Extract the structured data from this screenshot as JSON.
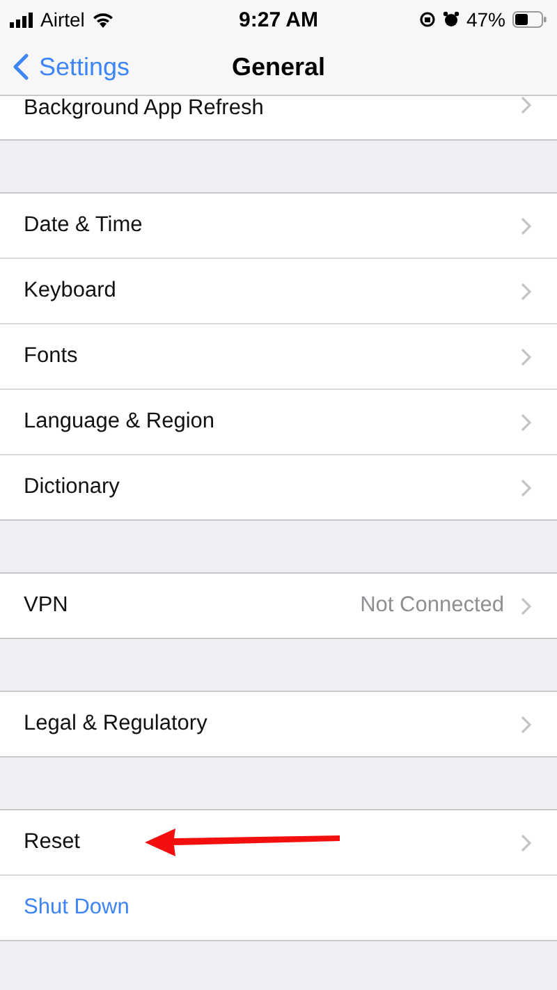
{
  "status_bar": {
    "carrier": "Airtel",
    "time": "9:27 AM",
    "battery": "47%"
  },
  "nav_bar": {
    "back": "Settings",
    "title": "General"
  },
  "groups": [
    {
      "partial": true,
      "rows": [
        {
          "kind": "nav",
          "label": "Background App Refresh"
        }
      ]
    },
    {
      "partial": false,
      "rows": [
        {
          "kind": "nav",
          "label": "Date & Time"
        },
        {
          "kind": "nav",
          "label": "Keyboard"
        },
        {
          "kind": "nav",
          "label": "Fonts"
        },
        {
          "kind": "nav",
          "label": "Language & Region"
        },
        {
          "kind": "nav",
          "label": "Dictionary"
        }
      ]
    },
    {
      "partial": false,
      "rows": [
        {
          "kind": "nav",
          "label": "VPN",
          "value": "Not Connected"
        }
      ]
    },
    {
      "partial": false,
      "rows": [
        {
          "kind": "nav",
          "label": "Legal & Regulatory"
        }
      ]
    },
    {
      "partial": false,
      "rows": [
        {
          "kind": "nav",
          "label": "Reset",
          "pointer": true
        },
        {
          "kind": "action",
          "label": "Shut Down"
        }
      ]
    }
  ]
}
